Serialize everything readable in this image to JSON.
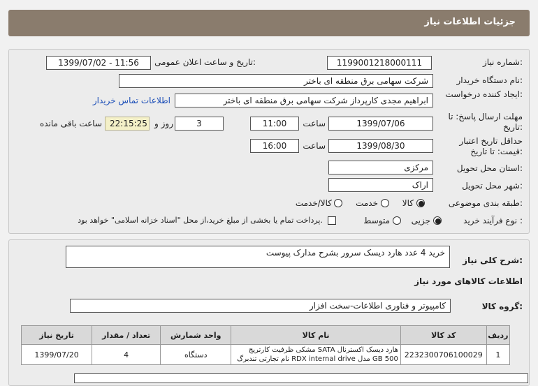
{
  "header": {
    "title": "جزئیات اطلاعات نیاز"
  },
  "labels": {
    "need_number": "شماره نیاز:",
    "announce_datetime": "تاریخ و ساعت اعلان عمومی:",
    "buyer_org": "نام دستگاه خریدار:",
    "requester": "ایجاد کننده درخواست:",
    "reply_deadline": "مهلت ارسال پاسخ: تا تاریخ:",
    "price_validity": "حداقل تاریخ اعتبار قیمت: تا تاریخ:",
    "time": "ساعت",
    "day_and": "روز و",
    "remaining": "ساعت باقی مانده",
    "province": "استان محل تحویل:",
    "city": "شهر محل تحویل:",
    "subject_class": "طبقه بندی موضوعی:",
    "purchase_type": "نوع فرآیند خرید :",
    "summary": "شرح کلی نیاز:",
    "goods_info": "اطلاعات کالاهای مورد نیاز",
    "goods_group": "گروه کالا:"
  },
  "fields": {
    "need_number": "1199001218000111",
    "announce_datetime": "1399/07/02 - 11:56",
    "buyer_org": "شرکت سهامی برق منطقه ای باختر",
    "requester": "ابراهیم مجدی کارپرداز شرکت سهامی برق منطقه ای باختر",
    "contact_link": "اطلاعات تماس خریدار",
    "reply_date": "1399/07/06",
    "reply_time": "11:00",
    "reply_days": "3",
    "reply_remaining": "22:15:25",
    "validity_date": "1399/08/30",
    "validity_time": "16:00",
    "province": "مرکزی",
    "city": "اراک",
    "summary": "خرید 4 عدد هارد دیسک  سرور بشرح مدارک پیوست",
    "goods_group": "کامپیوتر و فناوری اطلاعات-سخت افزار"
  },
  "subject_options": [
    {
      "label": "کالا",
      "selected": true
    },
    {
      "label": "خدمت",
      "selected": false
    },
    {
      "label": "کالا/خدمت",
      "selected": false
    }
  ],
  "purchase_options": [
    {
      "label": "جزیی",
      "selected": true
    },
    {
      "label": "متوسط",
      "selected": false
    }
  ],
  "purchase_note": "پرداخت تمام یا بخشی از مبلغ خرید،از محل \"اسناد خزانه اسلامی\" خواهد بود.",
  "table": {
    "headers": [
      "ردیف",
      "کد کالا",
      "نام کالا",
      "واحد شمارش",
      "تعداد / مقدار",
      "تاریخ نیاز"
    ],
    "rows": [
      [
        "1",
        "2232300706100029",
        "هارد دیسک اکسترنال SATA مشکی ظرفیت کارتریج 500 GB مدل RDX internal drive نام تجارتی تندبرگ",
        "دستگاه",
        "4",
        "1399/07/20"
      ]
    ]
  }
}
